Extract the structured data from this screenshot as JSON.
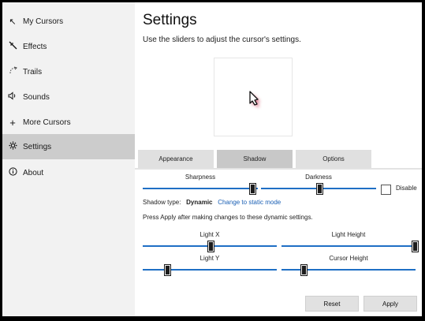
{
  "sidebar": {
    "items": [
      {
        "label": "My Cursors",
        "icon": "arrow-cursor-icon",
        "active": false
      },
      {
        "label": "Effects",
        "icon": "effects-wand-icon",
        "active": false
      },
      {
        "label": "Trails",
        "icon": "trails-icon",
        "active": false
      },
      {
        "label": "Sounds",
        "icon": "speaker-icon",
        "active": false
      },
      {
        "label": "More Cursors",
        "icon": "plus-icon",
        "active": false
      },
      {
        "label": "Settings",
        "icon": "gear-icon",
        "active": true
      },
      {
        "label": "About",
        "icon": "info-icon",
        "active": false
      }
    ]
  },
  "main": {
    "title": "Settings",
    "subtitle": "Use the sliders to adjust the cursor's settings."
  },
  "tabs": [
    {
      "label": "Appearance",
      "active": false
    },
    {
      "label": "Shadow",
      "active": true
    },
    {
      "label": "Options",
      "active": false
    }
  ],
  "shadow": {
    "sharpness_label": "Sharpness",
    "sharpness_value": 0.96,
    "darkness_label": "Darkness",
    "darkness_value": 0.5,
    "disable_label": "Disable",
    "disable_checked": false,
    "type_label": "Shadow type:",
    "type_value": "Dynamic",
    "change_link": "Change to static mode",
    "note": "Press Apply after making changes to these dynamic settings.",
    "light_x_label": "Light X",
    "light_x_value": 0.5,
    "light_height_label": "Light Height",
    "light_height_value": 1.0,
    "light_y_label": "Light Y",
    "light_y_value": 0.17,
    "cursor_height_label": "Cursor Height",
    "cursor_height_value": 0.15
  },
  "buttons": {
    "reset": "Reset",
    "apply": "Apply"
  },
  "colors": {
    "accent": "#1f6fc5",
    "sidebar_bg": "#f2f2f2",
    "sidebar_active": "#cccccc",
    "tab_bg": "#e0e0e0",
    "link": "#1a5fb4"
  }
}
